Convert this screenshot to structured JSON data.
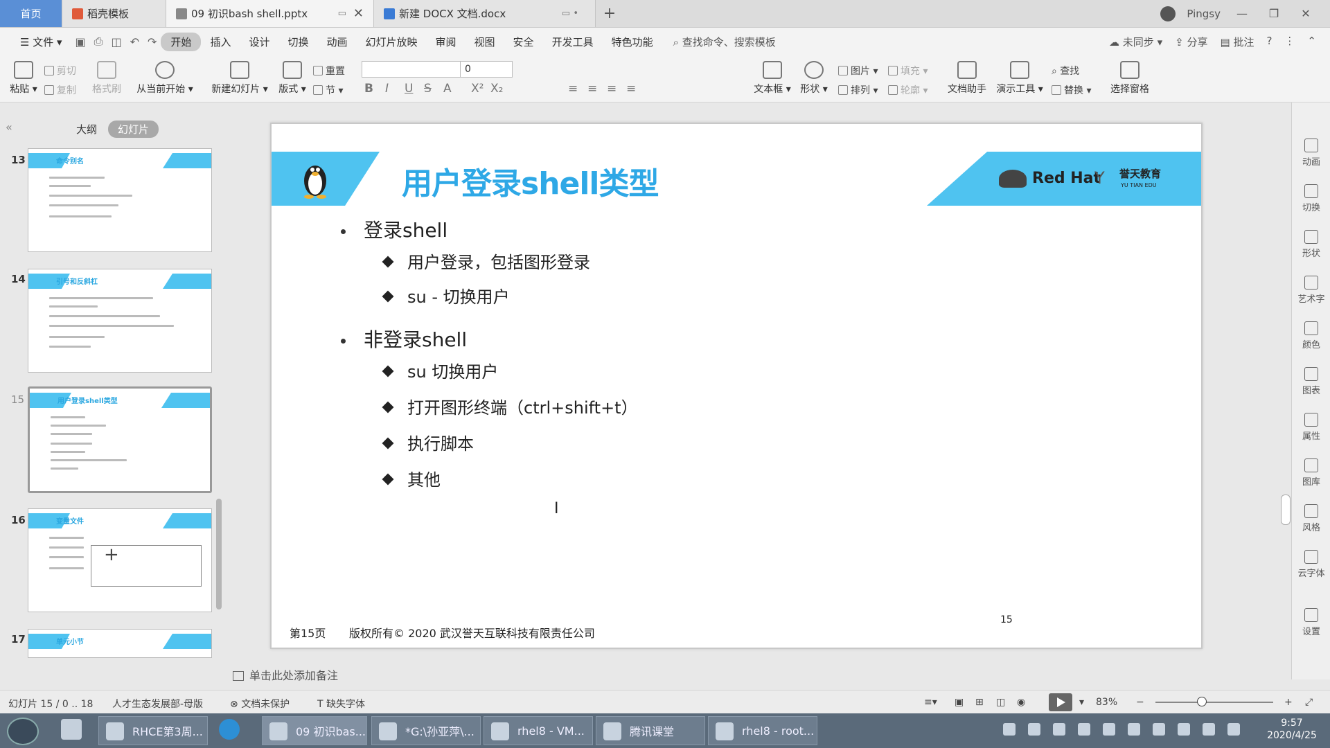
{
  "tabs": {
    "home": "首页",
    "template": "稻壳模板",
    "pptx": "09 初识bash shell.pptx",
    "docx": "新建 DOCX 文档.docx",
    "user": "Pingsy"
  },
  "menu": {
    "file": "文件",
    "items": [
      "开始",
      "插入",
      "设计",
      "切换",
      "动画",
      "幻灯片放映",
      "审阅",
      "视图",
      "安全",
      "开发工具",
      "特色功能"
    ],
    "search": "查找命令、搜索模板",
    "sync": "未同步",
    "share": "分享",
    "comment": "批注"
  },
  "ribbon": {
    "paste": "粘贴",
    "cut": "剪切",
    "copy": "复制",
    "format_painter": "格式刷",
    "from_current": "从当前开始",
    "new_slide": "新建幻灯片",
    "layout": "版式",
    "reset": "重置",
    "section": "节",
    "font_size": "0",
    "textbox": "文本框",
    "shape": "形状",
    "picture": "图片",
    "fill": "填充",
    "arrange": "排列",
    "outline": "轮廓",
    "doc_helper": "文档助手",
    "present_tools": "演示工具",
    "find": "查找",
    "replace": "替换",
    "select_pane": "选择窗格"
  },
  "left_panel": {
    "outline_tab": "大纲",
    "slides_tab": "幻灯片",
    "thumbnails": [
      {
        "num": "13",
        "title": "命令别名"
      },
      {
        "num": "14",
        "title": "引号和反斜杠"
      },
      {
        "num": "15",
        "title": "用户登录shell类型"
      },
      {
        "num": "16",
        "title": "变量文件"
      },
      {
        "num": "17",
        "title": "单元小节"
      }
    ]
  },
  "slide": {
    "title": "用户登录shell类型",
    "logo_redhat": "Red Hat",
    "logo_yt": "誉天教育",
    "logo_yt_sub": "YU TIAN EDU",
    "bullets": [
      {
        "text": "登录shell",
        "subs": [
          "用户登录，包括图形登录",
          "su - 切换用户"
        ]
      },
      {
        "text": "非登录shell",
        "subs": [
          "su 切换用户",
          "打开图形终端（ctrl+shift+t）",
          "执行脚本",
          "其他"
        ]
      }
    ],
    "footer_section": "第15页",
    "footer_copyright": "版权所有© 2020 武汉誉天互联科技有限责任公司",
    "page_number": "15"
  },
  "notes_placeholder": "单击此处添加备注",
  "right_toolbar": [
    "动画",
    "切换",
    "形状",
    "艺术字",
    "颜色",
    "图表",
    "属性",
    "图库",
    "风格",
    "云字体",
    "设置"
  ],
  "status": {
    "slide_pos": "幻灯片 15 / 0 .. 18",
    "theme": "人才生态发展部-母版",
    "doc_protect": "文档未保护",
    "missing_font": "缺失字体",
    "zoom": "83%"
  },
  "taskbar": {
    "apps": [
      "RHCE第3周...",
      "09 初识bas...",
      "*G:\\孙亚萍\\...",
      "rhel8 - VM...",
      "腾讯课堂",
      "rhel8 - root..."
    ],
    "time": "9:57",
    "date": "2020/4/25"
  },
  "colors": {
    "accent_blue": "#4fc3f0",
    "title_blue": "#2ea8e6",
    "home_tab": "#5a8fd6"
  }
}
